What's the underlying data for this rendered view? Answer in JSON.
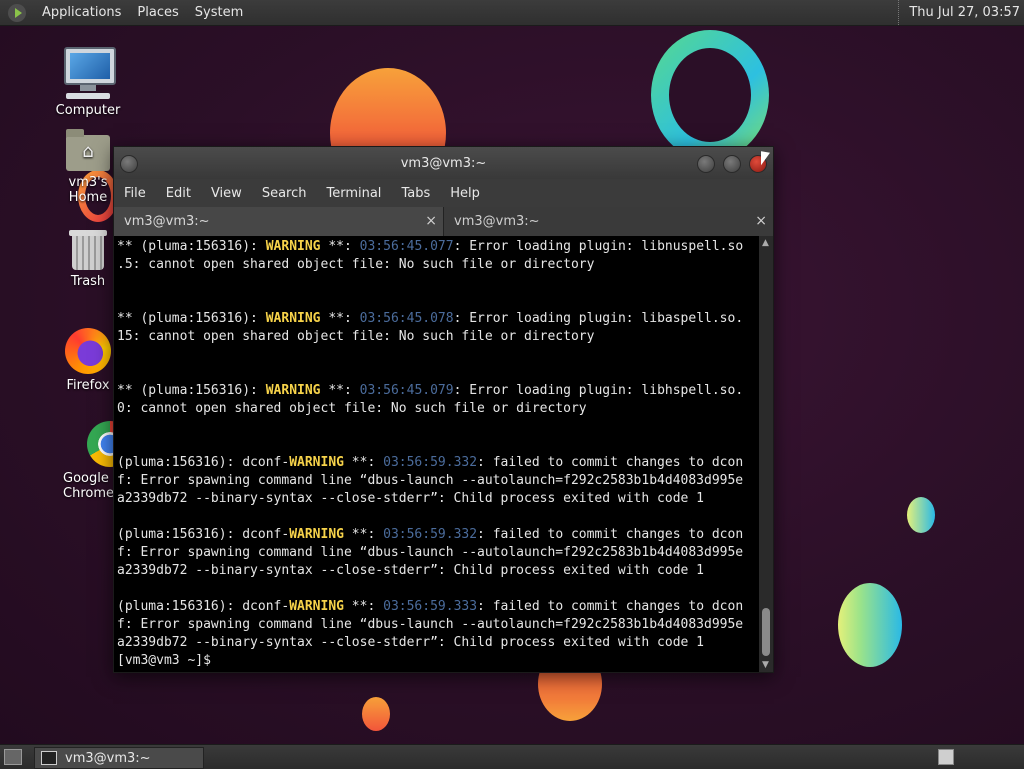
{
  "top_panel": {
    "menus": [
      "Applications",
      "Places",
      "System"
    ],
    "clock": "Thu Jul 27, 03:57"
  },
  "desktop_icons": [
    {
      "label": "Computer"
    },
    {
      "label": "vm3's Home"
    },
    {
      "label": "Trash"
    },
    {
      "label": "Firefox"
    },
    {
      "label": "Google Chrome"
    }
  ],
  "window": {
    "title": "vm3@vm3:~",
    "menu": [
      "File",
      "Edit",
      "View",
      "Search",
      "Terminal",
      "Tabs",
      "Help"
    ],
    "tabs": [
      {
        "label": "vm3@vm3:~"
      },
      {
        "label": "vm3@vm3:~"
      }
    ],
    "close_glyph": "×"
  },
  "terminal": {
    "lines": [
      {
        "parts": [
          [
            "t",
            "** (pluma:156316): "
          ],
          [
            "w",
            "WARNING"
          ],
          [
            "t",
            " **: "
          ],
          [
            "ts",
            "03:56:45.077"
          ],
          [
            "t",
            ": Error loading plugin: libnuspell.so"
          ]
        ]
      },
      {
        "parts": [
          [
            "t",
            ".5: cannot open shared object file: No such file or directory"
          ]
        ]
      },
      {
        "parts": [
          [
            "t",
            ""
          ]
        ]
      },
      {
        "parts": [
          [
            "t",
            ""
          ]
        ]
      },
      {
        "parts": [
          [
            "t",
            "** (pluma:156316): "
          ],
          [
            "w",
            "WARNING"
          ],
          [
            "t",
            " **: "
          ],
          [
            "ts",
            "03:56:45.078"
          ],
          [
            "t",
            ": Error loading plugin: libaspell.so."
          ]
        ]
      },
      {
        "parts": [
          [
            "t",
            "15: cannot open shared object file: No such file or directory"
          ]
        ]
      },
      {
        "parts": [
          [
            "t",
            ""
          ]
        ]
      },
      {
        "parts": [
          [
            "t",
            ""
          ]
        ]
      },
      {
        "parts": [
          [
            "t",
            "** (pluma:156316): "
          ],
          [
            "w",
            "WARNING"
          ],
          [
            "t",
            " **: "
          ],
          [
            "ts",
            "03:56:45.079"
          ],
          [
            "t",
            ": Error loading plugin: libhspell.so."
          ]
        ]
      },
      {
        "parts": [
          [
            "t",
            "0: cannot open shared object file: No such file or directory"
          ]
        ]
      },
      {
        "parts": [
          [
            "t",
            ""
          ]
        ]
      },
      {
        "parts": [
          [
            "t",
            ""
          ]
        ]
      },
      {
        "parts": [
          [
            "t",
            "(pluma:156316): dconf-"
          ],
          [
            "w",
            "WARNING"
          ],
          [
            "t",
            " **: "
          ],
          [
            "ts",
            "03:56:59.332"
          ],
          [
            "t",
            ": failed to commit changes to dcon"
          ]
        ]
      },
      {
        "parts": [
          [
            "t",
            "f: Error spawning command line “dbus-launch --autolaunch=f292c2583b1b4d4083d995e"
          ]
        ]
      },
      {
        "parts": [
          [
            "t",
            "a2339db72 --binary-syntax --close-stderr”: Child process exited with code 1"
          ]
        ]
      },
      {
        "parts": [
          [
            "t",
            ""
          ]
        ]
      },
      {
        "parts": [
          [
            "t",
            "(pluma:156316): dconf-"
          ],
          [
            "w",
            "WARNING"
          ],
          [
            "t",
            " **: "
          ],
          [
            "ts",
            "03:56:59.332"
          ],
          [
            "t",
            ": failed to commit changes to dcon"
          ]
        ]
      },
      {
        "parts": [
          [
            "t",
            "f: Error spawning command line “dbus-launch --autolaunch=f292c2583b1b4d4083d995e"
          ]
        ]
      },
      {
        "parts": [
          [
            "t",
            "a2339db72 --binary-syntax --close-stderr”: Child process exited with code 1"
          ]
        ]
      },
      {
        "parts": [
          [
            "t",
            ""
          ]
        ]
      },
      {
        "parts": [
          [
            "t",
            "(pluma:156316): dconf-"
          ],
          [
            "w",
            "WARNING"
          ],
          [
            "t",
            " **: "
          ],
          [
            "ts",
            "03:56:59.333"
          ],
          [
            "t",
            ": failed to commit changes to dcon"
          ]
        ]
      },
      {
        "parts": [
          [
            "t",
            "f: Error spawning command line “dbus-launch --autolaunch=f292c2583b1b4d4083d995e"
          ]
        ]
      },
      {
        "parts": [
          [
            "t",
            "a2339db72 --binary-syntax --close-stderr”: Child process exited with code 1"
          ]
        ]
      },
      {
        "parts": [
          [
            "t",
            "[vm3@vm3 ~]$ "
          ]
        ]
      }
    ]
  },
  "bottom_panel": {
    "task_label": "vm3@vm3:~"
  },
  "colors": {
    "warning": "#f7d34a",
    "timestamp": "#4b6c9c",
    "terminal_bg": "#000000"
  }
}
